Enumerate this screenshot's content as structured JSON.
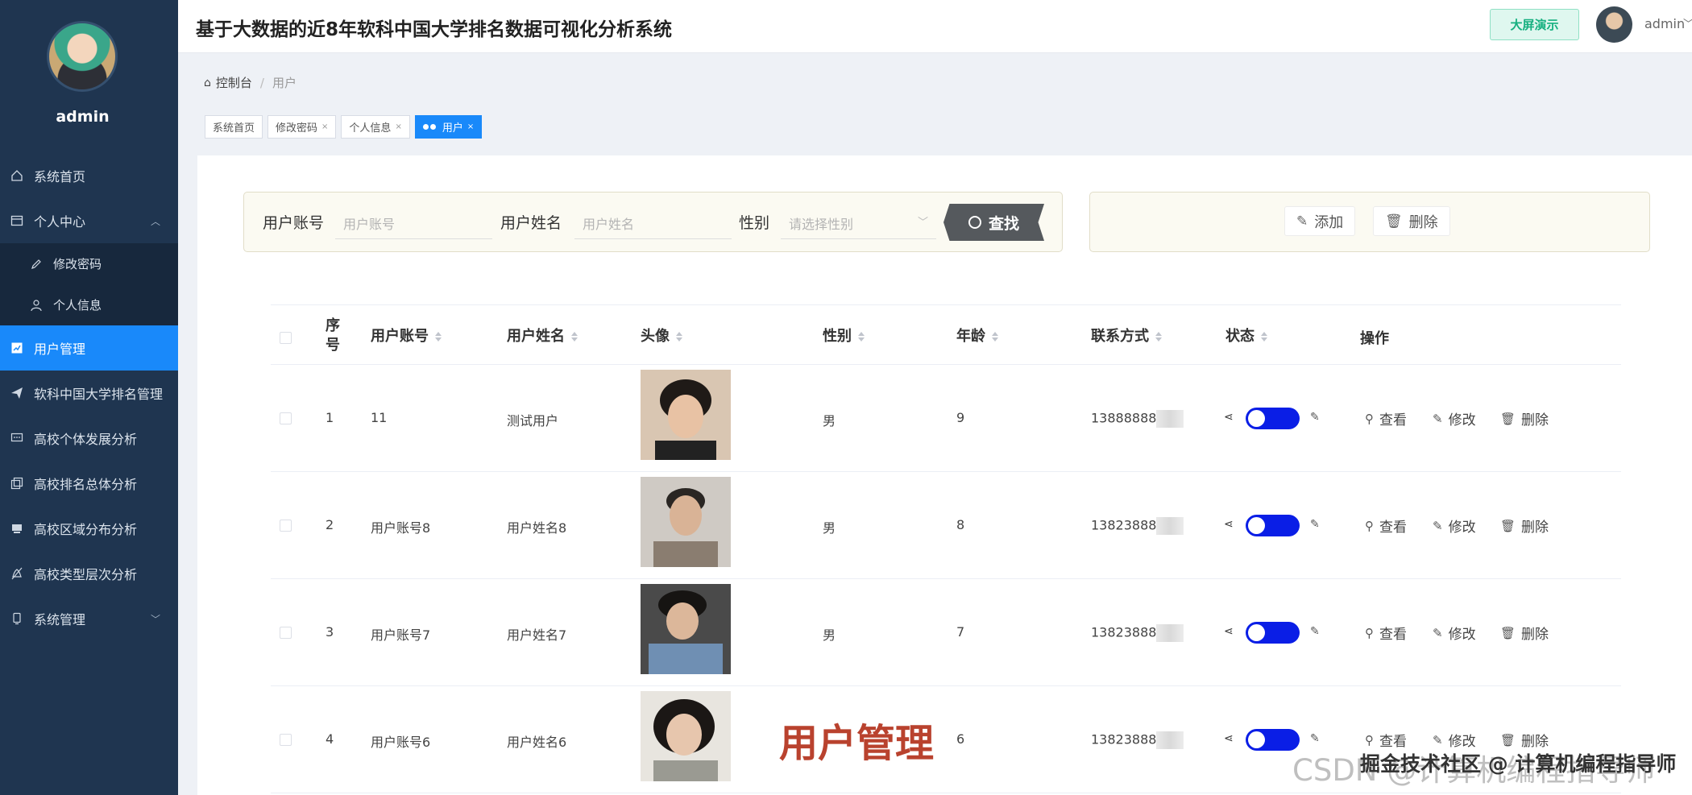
{
  "app": {
    "title": "基于大数据的近8年软科中国大学排名数据可视化分析系统",
    "screen_button": "大屏演示",
    "user": "admin"
  },
  "sidebar": {
    "username": "admin",
    "items": [
      {
        "label": "系统首页",
        "icon": "home-icon"
      },
      {
        "label": "个人中心",
        "icon": "window-icon"
      },
      {
        "label": "修改密码",
        "icon": "edit-icon"
      },
      {
        "label": "个人信息",
        "icon": "user-icon"
      },
      {
        "label": "用户管理",
        "icon": "chart-icon"
      },
      {
        "label": "软科中国大学排名管理",
        "icon": "send-icon"
      },
      {
        "label": "高校个体发展分析",
        "icon": "message-icon"
      },
      {
        "label": "高校排名总体分析",
        "icon": "copy-icon"
      },
      {
        "label": "高校区域分布分析",
        "icon": "box-icon"
      },
      {
        "label": "高校类型层次分析",
        "icon": "bell-off-icon"
      },
      {
        "label": "系统管理",
        "icon": "phone-icon"
      }
    ]
  },
  "breadcrumb": {
    "home": "控制台",
    "current": "用户"
  },
  "tags": [
    {
      "label": "系统首页"
    },
    {
      "label": "修改密码"
    },
    {
      "label": "个人信息"
    },
    {
      "label": "用户"
    }
  ],
  "search": {
    "account_label": "用户账号",
    "account_placeholder": "用户账号",
    "name_label": "用户姓名",
    "name_placeholder": "用户姓名",
    "gender_label": "性别",
    "gender_placeholder": "请选择性别",
    "button": "查找"
  },
  "actions": {
    "add": "添加",
    "delete": "删除"
  },
  "table": {
    "headers": {
      "index": "序号",
      "account": "用户账号",
      "name": "用户姓名",
      "avatar": "头像",
      "gender": "性别",
      "age": "年龄",
      "contact": "联系方式",
      "status": "状态",
      "ops": "操作"
    },
    "ops": {
      "view": "查看",
      "edit": "修改",
      "delete": "删除"
    },
    "rows": [
      {
        "index": "1",
        "account": "11",
        "name": "测试用户",
        "gender": "男",
        "age": "9",
        "contact": "13888888"
      },
      {
        "index": "2",
        "account": "用户账号8",
        "name": "用户姓名8",
        "gender": "男",
        "age": "8",
        "contact": "13823888"
      },
      {
        "index": "3",
        "account": "用户账号7",
        "name": "用户姓名7",
        "gender": "男",
        "age": "7",
        "contact": "13823888"
      },
      {
        "index": "4",
        "account": "用户账号6",
        "name": "用户姓名6",
        "gender": "",
        "age": "6",
        "contact": "13823888"
      }
    ]
  },
  "overlay_title": "用户管理",
  "watermark": {
    "back": "CSDN @计算机编程指导师",
    "front": "掘金技术社区 @ 计算机编程指导师"
  },
  "colors": {
    "sidebar": "#1f3550",
    "active": "#1989fa",
    "toggle": "#0a1ee6",
    "overlay": "#b9422e"
  }
}
